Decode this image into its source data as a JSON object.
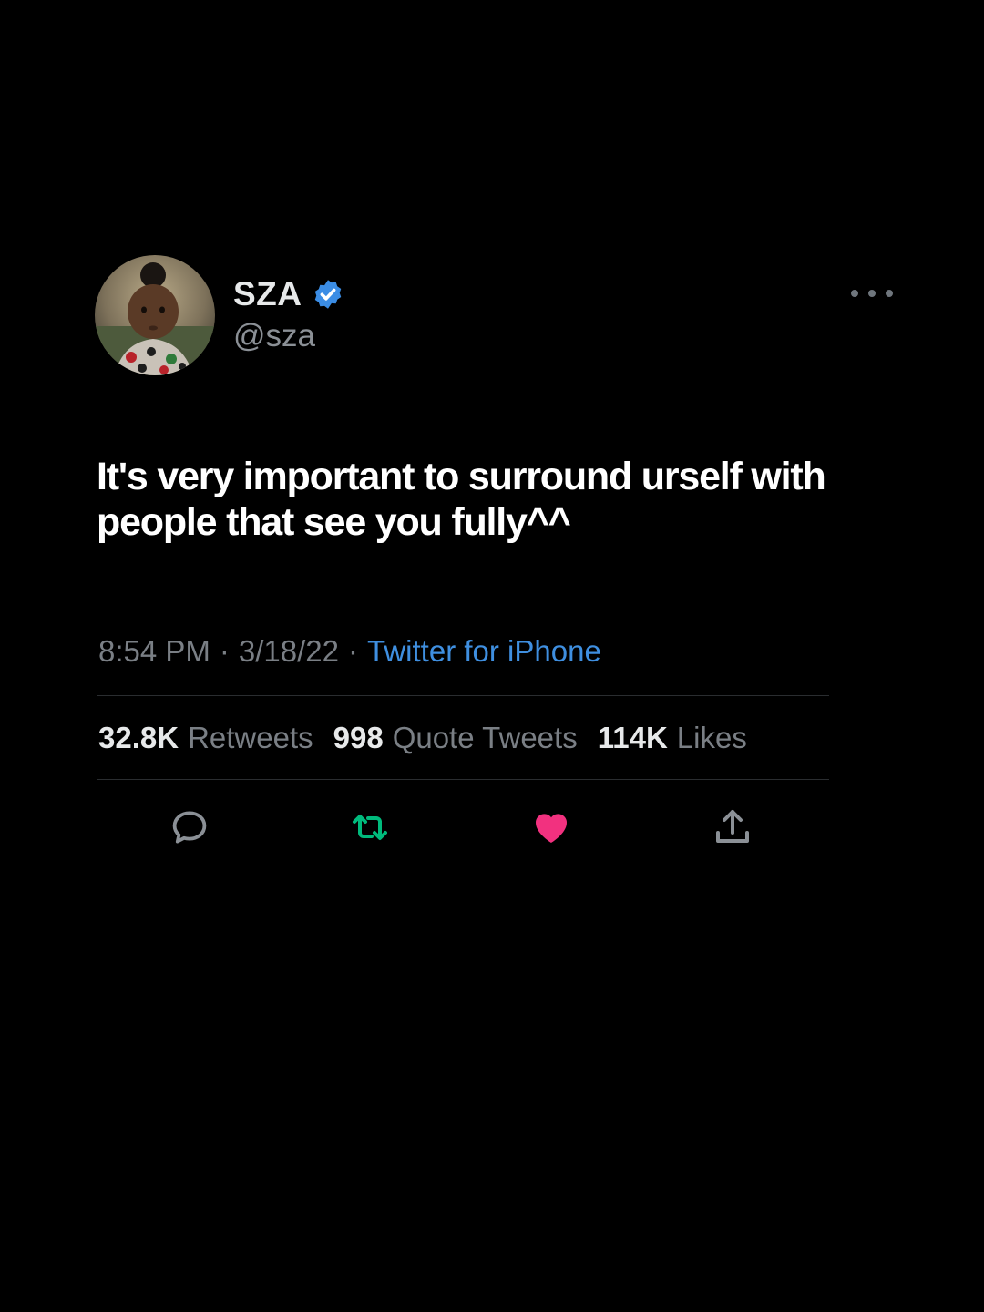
{
  "author": {
    "display_name": "SZA",
    "handle": "@sza",
    "verified": true
  },
  "tweet": {
    "text": "It's very important to surround urself with people that see you fully^^"
  },
  "meta": {
    "time": "8:54 PM",
    "separator": "·",
    "date": "3/18/22",
    "source": "Twitter for iPhone"
  },
  "stats": [
    {
      "count": "32.8K",
      "label": "Retweets"
    },
    {
      "count": "998",
      "label": "Quote Tweets"
    },
    {
      "count": "114K",
      "label": "Likes"
    }
  ],
  "actions": {
    "reply_icon": "reply-icon",
    "retweet_icon": "retweet-icon",
    "like_icon": "heart-icon",
    "share_icon": "share-icon"
  },
  "colors": {
    "background": "#000000",
    "link": "#3f8fe0",
    "verified": "#3b8de5",
    "retweet_active": "#00ba7c",
    "like_active": "#f2317f"
  }
}
